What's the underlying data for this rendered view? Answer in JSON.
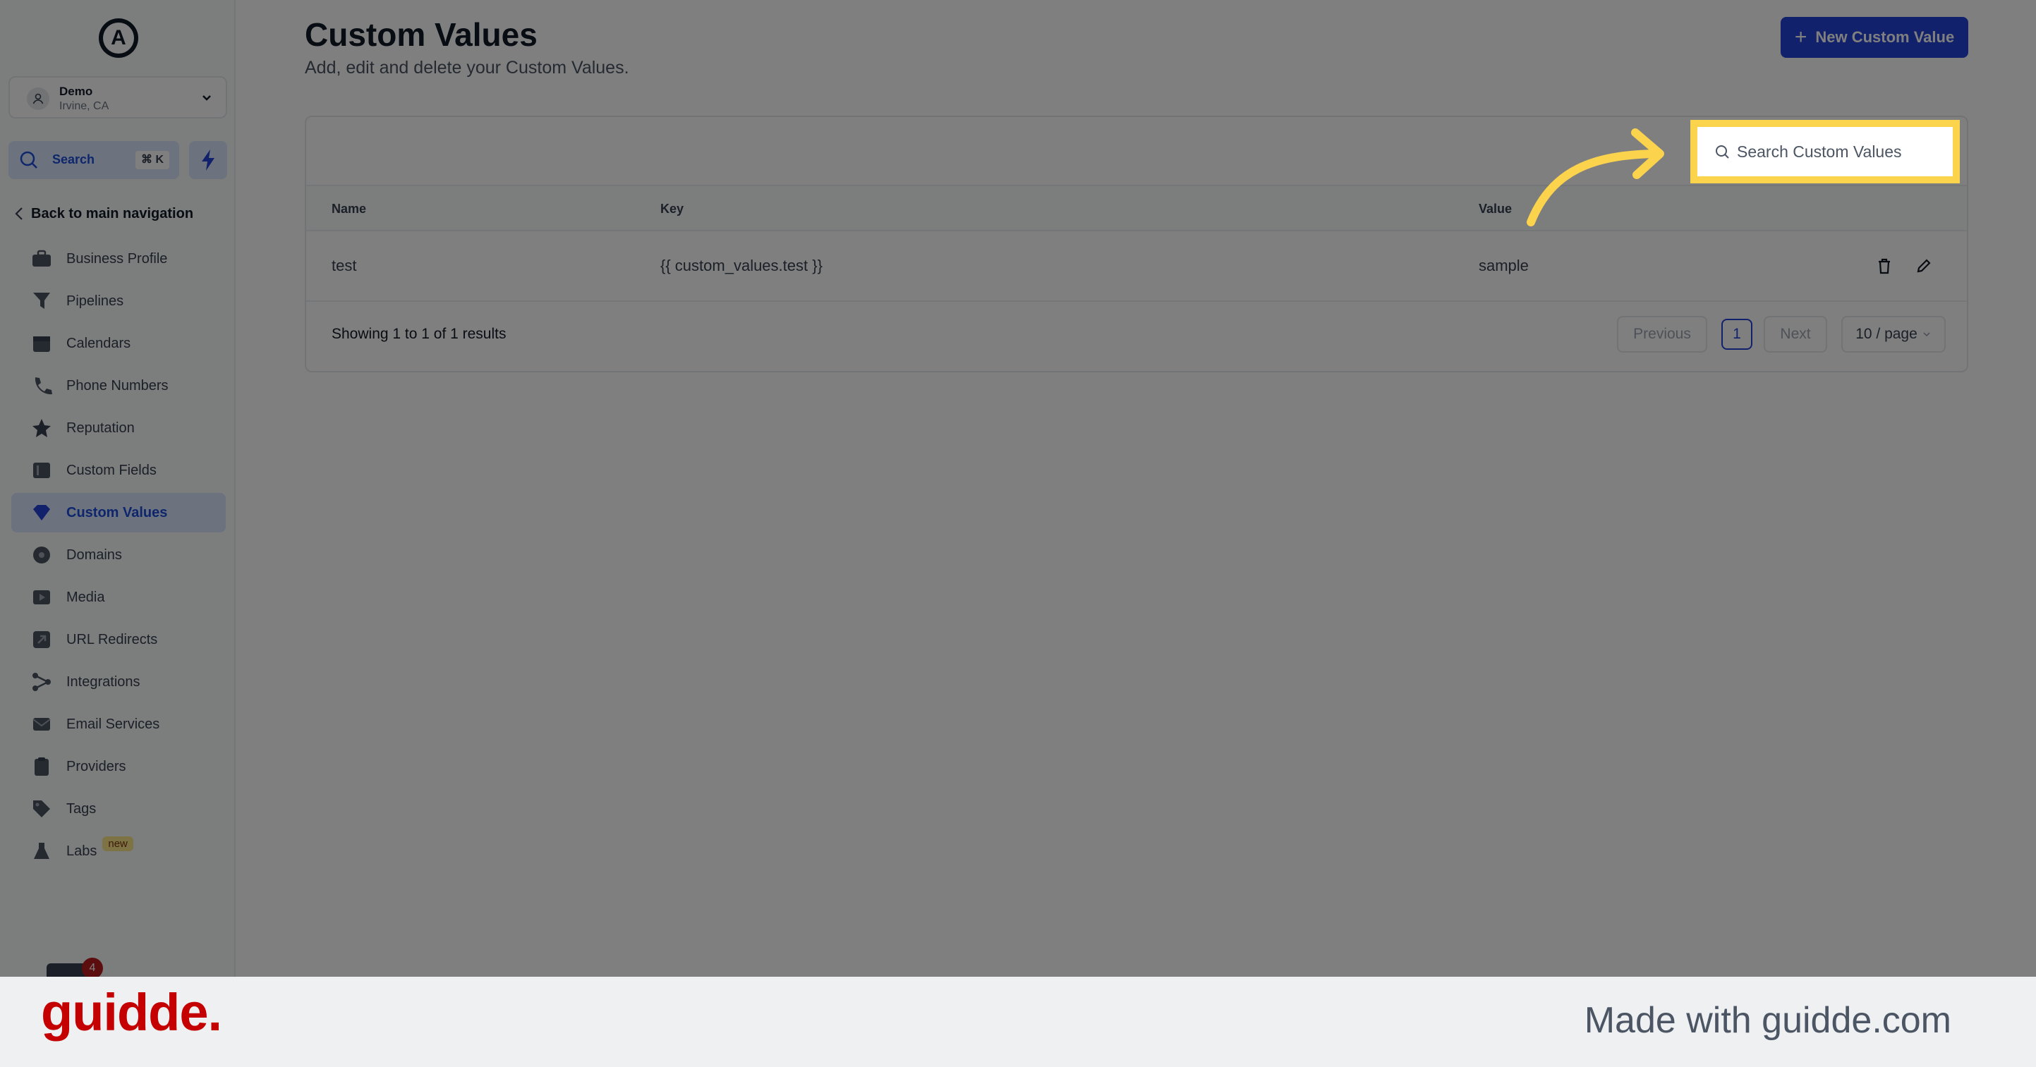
{
  "sidebar": {
    "account_name": "Demo",
    "account_location": "Irvine, CA",
    "search_label": "Search",
    "search_shortcut": "⌘ K",
    "back_label": "Back to main navigation",
    "items": [
      {
        "label": "Business Profile",
        "icon": "briefcase-icon"
      },
      {
        "label": "Pipelines",
        "icon": "funnel-icon"
      },
      {
        "label": "Calendars",
        "icon": "calendar-icon"
      },
      {
        "label": "Phone Numbers",
        "icon": "phone-icon"
      },
      {
        "label": "Reputation",
        "icon": "star-icon"
      },
      {
        "label": "Custom Fields",
        "icon": "fields-icon"
      },
      {
        "label": "Custom Values",
        "icon": "gem-icon",
        "active": true
      },
      {
        "label": "Domains",
        "icon": "globe-icon"
      },
      {
        "label": "Media",
        "icon": "media-icon"
      },
      {
        "label": "URL Redirects",
        "icon": "redirect-icon"
      },
      {
        "label": "Integrations",
        "icon": "integrations-icon"
      },
      {
        "label": "Email Services",
        "icon": "mail-icon"
      },
      {
        "label": "Providers",
        "icon": "clipboard-icon"
      },
      {
        "label": "Tags",
        "icon": "tag-icon"
      },
      {
        "label": "Labs",
        "icon": "flask-icon",
        "badge": "new"
      }
    ],
    "notification_count": "4"
  },
  "header": {
    "title": "Custom Values",
    "subtitle": "Add, edit and delete your Custom Values.",
    "new_button": "New Custom Value"
  },
  "table": {
    "search_placeholder": "Search Custom Values",
    "columns": [
      "Name",
      "Key",
      "Value"
    ],
    "rows": [
      {
        "name": "test",
        "key": "{{ custom_values.test }}",
        "value": "sample"
      }
    ],
    "results_text": "Showing 1 to 1 of 1 results",
    "prev_label": "Previous",
    "page_number": "1",
    "next_label": "Next",
    "page_size": "10 / page"
  },
  "footer": {
    "brand": "guidde.",
    "made_with": "Made with guidde.com"
  },
  "colors": {
    "accent": "#2543d9",
    "highlight": "#fcd34d",
    "brand": "#c40000"
  }
}
